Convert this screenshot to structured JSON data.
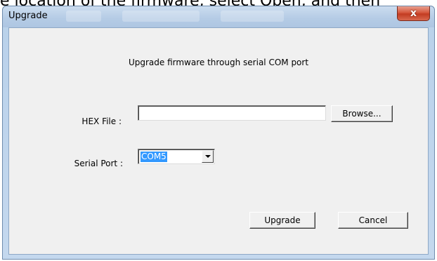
{
  "caption": "e location of the firmware, select Open, and then",
  "window": {
    "title": "Upgrade",
    "close_glyph": "x"
  },
  "dialog": {
    "heading": "Upgrade firmware through serial COM port",
    "hex_file_label": "HEX File :",
    "hex_file_value": "",
    "browse_label": "Browse...",
    "serial_port_label": "Serial Port :",
    "serial_port_selected": "COM5",
    "upgrade_label": "Upgrade",
    "cancel_label": "Cancel"
  }
}
